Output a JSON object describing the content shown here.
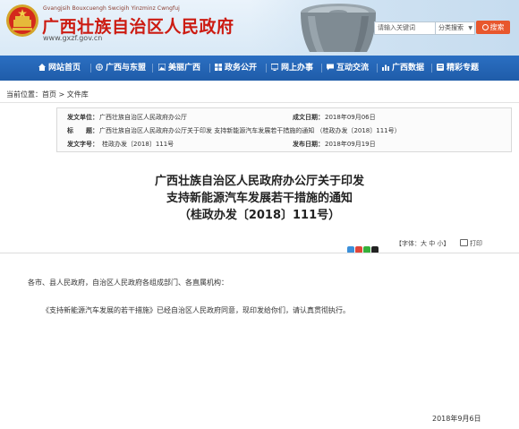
{
  "header": {
    "pinyin": "Gvangjsih Bouxcuengh Swcigih Yinzminz Cwngfuj",
    "title": "广西壮族自治区人民政府",
    "url": "www.gxzf.gov.cn",
    "search_placeholder": "请输入关键词",
    "search_category": "分类搜索",
    "search_button": "搜索"
  },
  "nav": {
    "items": [
      {
        "label": "网站首页"
      },
      {
        "label": "广西与东盟"
      },
      {
        "label": "美丽广西"
      },
      {
        "label": "政务公开"
      },
      {
        "label": "网上办事"
      },
      {
        "label": "互动交流"
      },
      {
        "label": "广西数据"
      },
      {
        "label": "精彩专题"
      }
    ]
  },
  "breadcrumb": {
    "prefix": "当前位置：",
    "home": "首页",
    "arrow": " > ",
    "current": "文件库"
  },
  "meta": {
    "issuer_label": "发文单位：",
    "issuer": "广西壮族自治区人民政府办公厅",
    "date_label": "成文日期：",
    "date": "2018年09月06日",
    "title_label": "标　　题：",
    "title": "广西壮族自治区人民政府办公厅关于印发 支持新能源汽车发展若干措施的通知 （桂政办发〔2018〕111号）",
    "number_label": "发文字号：",
    "number": "桂政办发〔2018〕111号",
    "publish_label": "发布日期：",
    "publish": "2018年09月19日"
  },
  "article": {
    "title_lines": [
      "广西壮族自治区人民政府办公厅关于印发",
      "支持新能源汽车发展若干措施的通知",
      "（桂政办发〔2018〕111号）"
    ],
    "font_tool": "【字体：大 中 小】",
    "print_tool": "打印",
    "salutation": "各市、县人民政府，自治区人民政府各组成部门、各直属机构：",
    "body": "《支持新能源汽车发展的若干措施》已经自治区人民政府同意，现印发给你们，请认真贯彻执行。",
    "date": "2018年9月6日"
  },
  "colors": {
    "brand_red": "#cc1b12",
    "nav_blue": "#2466b8",
    "search_orange": "#e8572d"
  }
}
